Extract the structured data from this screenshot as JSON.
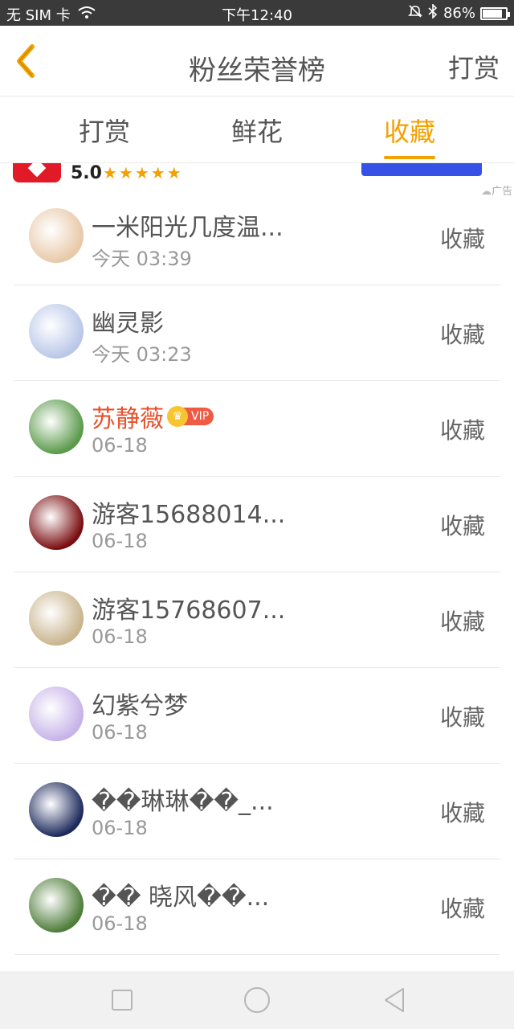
{
  "status_bar": {
    "carrier": "无 SIM 卡",
    "time": "下午12:40",
    "battery_percent": "86%",
    "battery_level": 0.86
  },
  "header": {
    "title": "粉丝荣誉榜",
    "action_label": "打赏",
    "back_icon": "chevron-left-icon",
    "accent_color": "#f3a100"
  },
  "tabs": [
    {
      "label": "打赏",
      "active": false
    },
    {
      "label": "鲜花",
      "active": false
    },
    {
      "label": "收藏",
      "active": true
    }
  ],
  "ad": {
    "rating": "5.0",
    "stars": "★★★★★",
    "label": "广告"
  },
  "fans": [
    {
      "name": "一米阳光几度温...",
      "time": "今天 03:39",
      "action": "收藏",
      "vip": false,
      "avatar_color": "#e8c9a8"
    },
    {
      "name": "幽灵影",
      "time": "今天 03:23",
      "action": "收藏",
      "vip": false,
      "avatar_color": "#b9c7e8"
    },
    {
      "name": "苏静薇",
      "time": "06-18",
      "action": "收藏",
      "vip": true,
      "vip_label": "VIP",
      "avatar_color": "#5a9a4a"
    },
    {
      "name": "游客15688014...",
      "time": "06-18",
      "action": "收藏",
      "vip": false,
      "avatar_color": "#7a0d10"
    },
    {
      "name": "游客15768607...",
      "time": "06-18",
      "action": "收藏",
      "vip": false,
      "avatar_color": "#c9b48e"
    },
    {
      "name": "幻紫兮梦",
      "time": "06-18",
      "action": "收藏",
      "vip": false,
      "avatar_color": "#c6b3e8"
    },
    {
      "name": "��琳琳��_...",
      "time": "06-18",
      "action": "收藏",
      "vip": false,
      "avatar_color": "#1d2a5c"
    },
    {
      "name": "�� 晓风��...",
      "time": "06-18",
      "action": "收藏",
      "vip": false,
      "avatar_color": "#4f7d3a"
    }
  ],
  "bottom_nav": {
    "icons": [
      "recent-apps-icon",
      "home-icon",
      "back-triangle-icon"
    ]
  }
}
